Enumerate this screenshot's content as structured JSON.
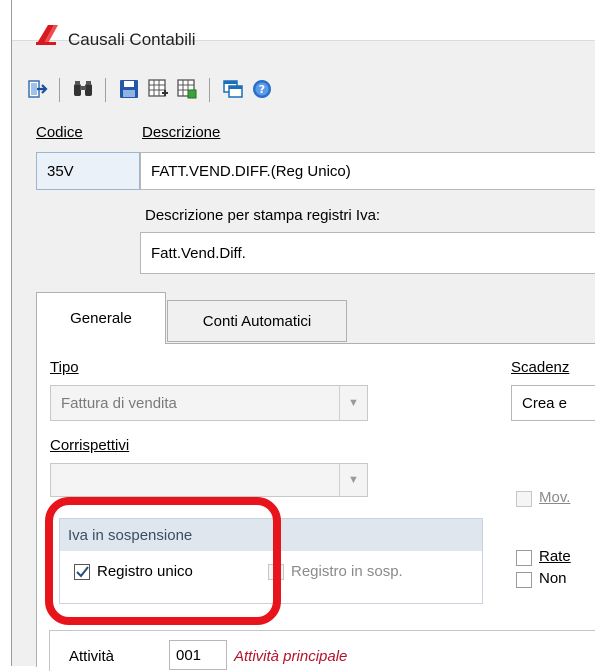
{
  "window": {
    "title": "Causali Contabili",
    "accent": "#e8141c"
  },
  "toolbar": {
    "icons": [
      "exit-icon",
      "search-binoculars-icon",
      "save-icon",
      "grid-add-icon",
      "grid-copy-icon",
      "windows-icon",
      "help-icon"
    ]
  },
  "header": {
    "codice_label": "Codice",
    "descrizione_label": "Descrizione",
    "codice_value": "35V",
    "descrizione_value": "FATT.VEND.DIFF.(Reg Unico)",
    "stampa_label": "Descrizione per stampa registri Iva:",
    "stampa_value": "Fatt.Vend.Diff."
  },
  "tabs": [
    {
      "label": "Generale",
      "active": true
    },
    {
      "label": "Conti Automatici",
      "active": false
    }
  ],
  "generale": {
    "tipo_label": "Tipo",
    "tipo_value": "Fattura di vendita",
    "corrispettivi_label": "Corrispettivi",
    "corrispettivi_value": "",
    "scadenze_label": "Scadenz",
    "scadenze_value": "Crea e",
    "mov_label": "Mov.",
    "rate_label": "Rate",
    "non_label": "Non",
    "iva_group_title": "Iva in sospensione",
    "registro_unico_label": "Registro unico",
    "registro_unico_checked": true,
    "registro_sosp_label": "Registro in sosp.",
    "registro_sosp_checked": false,
    "attivita_label": "Attività",
    "attivita_code": "001",
    "attivita_desc": "Attività principale"
  }
}
